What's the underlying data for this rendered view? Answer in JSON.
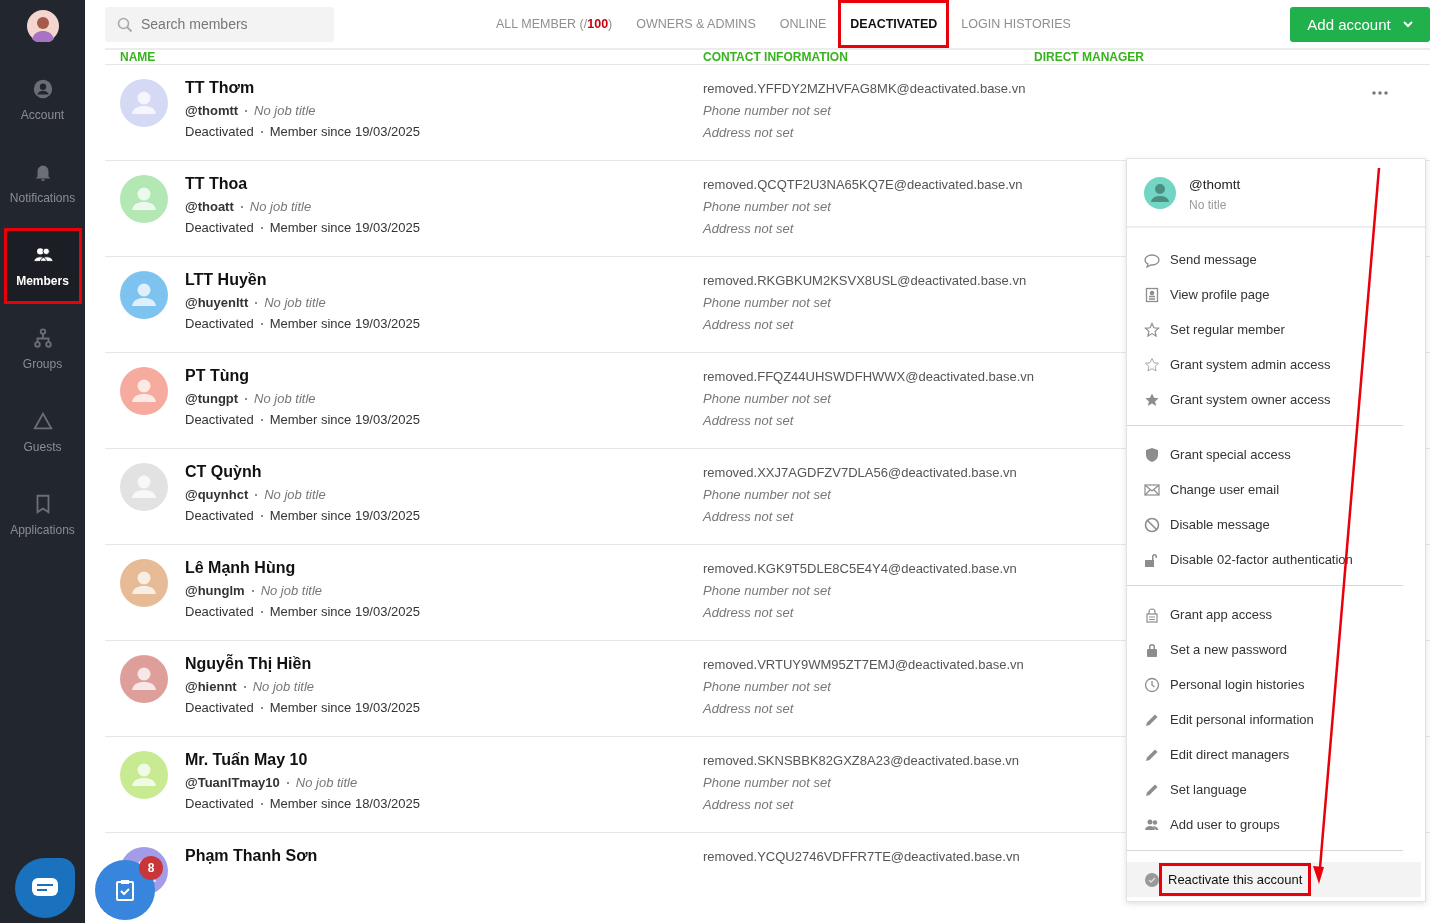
{
  "sidebar": {
    "items": [
      {
        "label": "Account",
        "selected": false,
        "annotated": false
      },
      {
        "label": "Notifications",
        "selected": false,
        "annotated": false
      },
      {
        "label": "Members",
        "selected": true,
        "annotated": true
      },
      {
        "label": "Groups",
        "selected": false,
        "annotated": false
      },
      {
        "label": "Guests",
        "selected": false,
        "annotated": false
      },
      {
        "label": "Applications",
        "selected": false,
        "annotated": false
      }
    ]
  },
  "search": {
    "placeholder": "Search members"
  },
  "tabs": [
    {
      "label": "ALL MEMBER (/",
      "count": "100",
      "suffix": ")",
      "selected": false,
      "annotated": false
    },
    {
      "label": "OWNERS & ADMINS",
      "selected": false,
      "annotated": false
    },
    {
      "label": "ONLINE",
      "selected": false,
      "annotated": false
    },
    {
      "label": "DEACTIVATED",
      "selected": true,
      "annotated": true
    },
    {
      "label": "LOGIN HISTORIES",
      "selected": false,
      "annotated": false
    }
  ],
  "add_button": {
    "label": "Add account"
  },
  "table": {
    "columns": [
      "NAME",
      "CONTACT INFORMATION",
      "DIRECT MANAGER"
    ],
    "rows": [
      {
        "name": "TT Thơm",
        "handle": "@thomtt",
        "job_title": "No job title",
        "status": "Deactivated",
        "since": "Member since 19/03/2025",
        "email": "removed.YFFDY2MZHVFAG8MK@deactivated.base.vn",
        "phone": "Phone number not set",
        "address": "Address not set",
        "color": "#d5d9f3"
      },
      {
        "name": "TT Thoa",
        "handle": "@thoatt",
        "job_title": "No job title",
        "status": "Deactivated",
        "since": "Member since 19/03/2025",
        "email": "removed.QCQTF2U3NA65KQ7E@deactivated.base.vn",
        "phone": "Phone number not set",
        "address": "Address not set",
        "color": "#b3e8b5"
      },
      {
        "name": "LTT Huyền",
        "handle": "@huyenltt",
        "job_title": "No job title",
        "status": "Deactivated",
        "since": "Member since 19/03/2025",
        "email": "removed.RKGBKUM2KSVX8USL@deactivated.base.vn",
        "phone": "Phone number not set",
        "address": "Address not set",
        "color": "#7ec3f0"
      },
      {
        "name": "PT Tùng",
        "handle": "@tungpt",
        "job_title": "No job title",
        "status": "Deactivated",
        "since": "Member since 19/03/2025",
        "email": "removed.FFQZ44UHSWDFHWWX@deactivated.base.vn",
        "phone": "Phone number not set",
        "address": "Address not set",
        "color": "#f6ab9f"
      },
      {
        "name": "CT Quỳnh",
        "handle": "@quynhct",
        "job_title": "No job title",
        "status": "Deactivated",
        "since": "Member since 19/03/2025",
        "email": "removed.XXJ7AGDFZV7DLA56@deactivated.base.vn",
        "phone": "Phone number not set",
        "address": "Address not set",
        "color": "#e2e2e2"
      },
      {
        "name": "Lê Mạnh Hùng",
        "handle": "@hunglm",
        "job_title": "No job title",
        "status": "Deactivated",
        "since": "Member since 19/03/2025",
        "email": "removed.KGK9T5DLE8C5E4Y4@deactivated.base.vn",
        "phone": "Phone number not set",
        "address": "Address not set",
        "color": "#e6bb95"
      },
      {
        "name": "Nguyễn Thị Hiền",
        "handle": "@hiennt",
        "job_title": "No job title",
        "status": "Deactivated",
        "since": "Member since 19/03/2025",
        "email": "removed.VRTUY9WM95ZT7EMJ@deactivated.base.vn",
        "phone": "Phone number not set",
        "address": "Address not set",
        "color": "#de9f9b"
      },
      {
        "name": "Mr. Tuấn May 10",
        "handle": "@TuanITmay10",
        "job_title": "No job title",
        "status": "Deactivated",
        "since": "Member since 18/03/2025",
        "email": "removed.SKNSBBK82GXZ8A23@deactivated.base.vn",
        "phone": "Phone number not set",
        "address": "Address not set",
        "color": "#c8ea93"
      },
      {
        "name": "Phạm Thanh Sơn",
        "email": "removed.YCQU2746VDFFR7TE@deactivated.base.vn",
        "color": "#a39ce8"
      }
    ]
  },
  "menu": {
    "handle": "@thomtt",
    "subtitle": "No title",
    "sections": [
      [
        {
          "label": "Send message",
          "highlighted": false,
          "annotated": false
        },
        {
          "label": "View profile page",
          "highlighted": false,
          "annotated": false
        },
        {
          "label": "Set regular member",
          "highlighted": false,
          "annotated": false
        },
        {
          "label": "Grant system admin access",
          "highlighted": false,
          "annotated": false
        },
        {
          "label": "Grant system owner access",
          "highlighted": false,
          "annotated": false
        }
      ],
      [
        {
          "label": "Grant special access",
          "highlighted": false,
          "annotated": false
        },
        {
          "label": "Change user email",
          "highlighted": false,
          "annotated": false
        },
        {
          "label": "Disable message",
          "highlighted": false,
          "annotated": false
        },
        {
          "label": "Disable 02-factor authentication",
          "highlighted": false,
          "annotated": false
        }
      ],
      [
        {
          "label": "Grant app access",
          "highlighted": false,
          "annotated": false
        },
        {
          "label": "Set a new password",
          "highlighted": false,
          "annotated": false
        },
        {
          "label": "Personal login histories",
          "highlighted": false,
          "annotated": false
        },
        {
          "label": "Edit personal information",
          "highlighted": false,
          "annotated": false
        },
        {
          "label": "Edit direct managers",
          "highlighted": false,
          "annotated": false
        },
        {
          "label": "Set language",
          "highlighted": false,
          "annotated": false
        },
        {
          "label": "Add user to groups",
          "highlighted": false,
          "annotated": false
        }
      ],
      [
        {
          "label": "Reactivate this account",
          "highlighted": true,
          "annotated": true
        }
      ]
    ]
  },
  "task_badge": "8"
}
